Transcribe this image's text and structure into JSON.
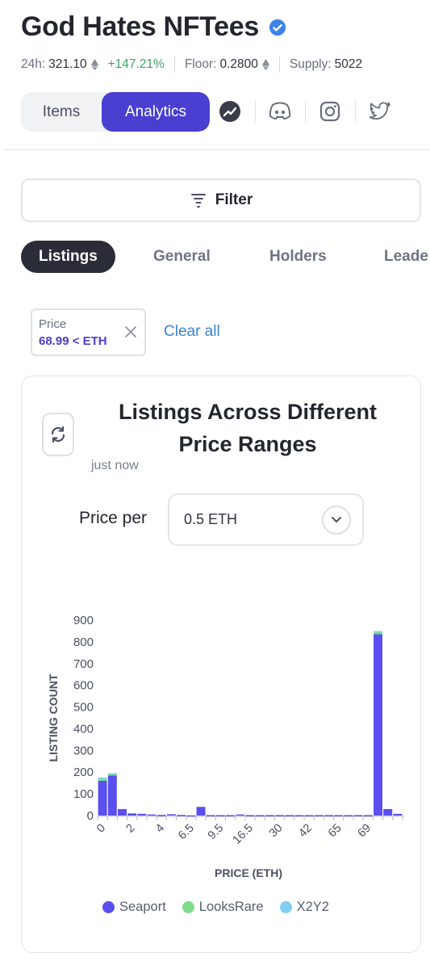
{
  "collection": {
    "name": "God Hates NFTees",
    "verified": true
  },
  "stats": {
    "volume_label": "24h:",
    "volume_value": "321.10",
    "change": "+147.21%",
    "floor_label": "Floor:",
    "floor_value": "0.2800",
    "supply_label": "Supply:",
    "supply_value": "5022"
  },
  "tabs": [
    {
      "label": "Items",
      "active": false
    },
    {
      "label": "Analytics",
      "active": true
    }
  ],
  "social_icons": [
    "analytics-chart-icon",
    "discord-icon",
    "instagram-icon",
    "twitter-icon"
  ],
  "filter_label": "Filter",
  "subtabs": [
    {
      "label": "Listings",
      "active": true
    },
    {
      "label": "General",
      "active": false
    },
    {
      "label": "Holders",
      "active": false
    },
    {
      "label": "Leade",
      "active": false
    }
  ],
  "active_filter": {
    "label": "Price",
    "value": "68.99 < ETH"
  },
  "clear_all_label": "Clear all",
  "card": {
    "title": "Listings Across Different Price Ranges",
    "updated": "just now",
    "price_per_label": "Price per",
    "price_per_value": "0.5 ETH"
  },
  "colors": {
    "accent": "#4a3fd1",
    "seaport": "#5b4ff0",
    "looksrare": "#7fdc8c",
    "x2y2": "#7fd0f3",
    "positive": "#3ca569",
    "link": "#3b84d6"
  },
  "chart_data": {
    "type": "bar",
    "stacked": true,
    "xlabel": "PRICE (ETH)",
    "ylabel": "LISTING COUNT",
    "ylim": [
      0,
      900
    ],
    "yticks": [
      0,
      100,
      200,
      300,
      400,
      500,
      600,
      700,
      800,
      900
    ],
    "xtick_labels": [
      "0",
      "2",
      "4",
      "6.5",
      "9.5",
      "16.5",
      "30",
      "42",
      "65",
      "69"
    ],
    "xtick_bins": [
      1,
      4,
      7,
      10,
      13,
      16,
      19,
      22,
      25,
      28
    ],
    "bins": 31,
    "legend_position": "bottom",
    "series": [
      {
        "name": "Seaport",
        "color": "#5b4ff0",
        "values": [
          160,
          185,
          30,
          10,
          8,
          5,
          3,
          6,
          3,
          1,
          40,
          2,
          2,
          2,
          5,
          2,
          2,
          2,
          2,
          2,
          2,
          2,
          2,
          2,
          2,
          2,
          2,
          2,
          835,
          30,
          8
        ]
      },
      {
        "name": "LooksRare",
        "color": "#7fdc8c",
        "values": [
          10,
          8,
          0,
          0,
          0,
          0,
          0,
          0,
          0,
          0,
          0,
          0,
          0,
          0,
          0,
          0,
          0,
          0,
          0,
          0,
          0,
          0,
          0,
          0,
          0,
          0,
          0,
          0,
          12,
          0,
          0
        ]
      },
      {
        "name": "X2Y2",
        "color": "#7fd0f3",
        "values": [
          5,
          2,
          0,
          0,
          0,
          0,
          0,
          0,
          0,
          0,
          0,
          0,
          0,
          0,
          0,
          0,
          0,
          0,
          0,
          0,
          0,
          0,
          0,
          0,
          0,
          0,
          0,
          0,
          3,
          0,
          0
        ]
      }
    ]
  }
}
